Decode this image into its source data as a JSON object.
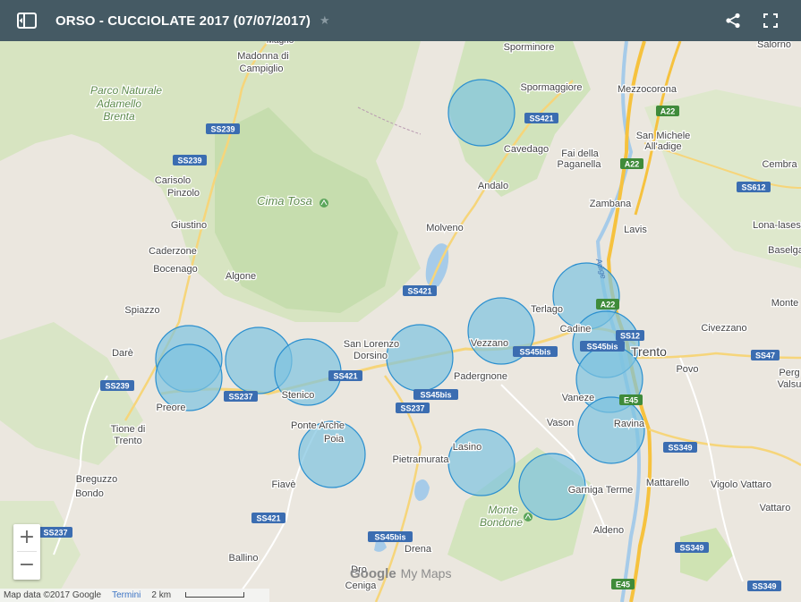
{
  "header": {
    "title": "ORSO - CUCCIOLATE 2017 (07/07/2017)",
    "star_icon": "star-icon",
    "share_icon": "share-icon",
    "fullscreen_icon": "fullscreen-icon",
    "menu_icon": "open-sidebar-icon"
  },
  "colors": {
    "header_bg": "#455a64",
    "circle_fill": "#7ec3df",
    "circle_stroke": "#2a8fcf",
    "road_highway": "#f6c23e",
    "terrain_green": "#cfe3b3"
  },
  "map": {
    "labels": [
      {
        "id": "parco",
        "text": "Parco Naturale"
      },
      {
        "id": "adamello",
        "text": "Adamello"
      },
      {
        "id": "brenta",
        "text": "Brenta"
      },
      {
        "id": "madonna",
        "text": "Madonna di"
      },
      {
        "id": "campiglio",
        "text": "Campiglio"
      },
      {
        "id": "magno",
        "text": "Magno"
      },
      {
        "id": "carisolo",
        "text": "Carisolo"
      },
      {
        "id": "pinzolo",
        "text": "Pinzolo"
      },
      {
        "id": "giustino",
        "text": "Giustino"
      },
      {
        "id": "caderzone",
        "text": "Caderzone"
      },
      {
        "id": "bocenago",
        "text": "Bocenago"
      },
      {
        "id": "algone",
        "text": "Algone"
      },
      {
        "id": "spiazzo",
        "text": "Spiazzo"
      },
      {
        "id": "dare",
        "text": "Darè"
      },
      {
        "id": "preore",
        "text": "Preore"
      },
      {
        "id": "tione",
        "text": "Tione di"
      },
      {
        "id": "trento2",
        "text": "Trento"
      },
      {
        "id": "breguzzo",
        "text": "Breguzzo"
      },
      {
        "id": "bondo",
        "text": "Bondo"
      },
      {
        "id": "cimatosa",
        "text": "Cima Tosa"
      },
      {
        "id": "stenico",
        "text": "Stenico"
      },
      {
        "id": "pontearche",
        "text": "Ponte Arche"
      },
      {
        "id": "poia",
        "text": "Poia"
      },
      {
        "id": "fiave",
        "text": "Fiavè"
      },
      {
        "id": "ballino",
        "text": "Ballino"
      },
      {
        "id": "sanlorenzo",
        "text": "San Lorenzo"
      },
      {
        "id": "dorsino",
        "text": "Dorsino"
      },
      {
        "id": "molveno",
        "text": "Molveno"
      },
      {
        "id": "andalo",
        "text": "Andalo"
      },
      {
        "id": "cavedago",
        "text": "Cavedago"
      },
      {
        "id": "sporminore",
        "text": "Sporminore"
      },
      {
        "id": "spormaggiore",
        "text": "Spormaggiore"
      },
      {
        "id": "fai",
        "text": "Fai della"
      },
      {
        "id": "paganella",
        "text": "Paganella"
      },
      {
        "id": "mezzocorona",
        "text": "Mezzocorona"
      },
      {
        "id": "sanmichele",
        "text": "San Michele"
      },
      {
        "id": "alladige",
        "text": "All'adige"
      },
      {
        "id": "salorno",
        "text": "Salorno"
      },
      {
        "id": "cembra",
        "text": "Cembra"
      },
      {
        "id": "zambana",
        "text": "Zambana"
      },
      {
        "id": "lavis",
        "text": "Lavis"
      },
      {
        "id": "lonalases",
        "text": "Lona-lases"
      },
      {
        "id": "baselga",
        "text": "Baselga"
      },
      {
        "id": "monte",
        "text": "Monte"
      },
      {
        "id": "terlago",
        "text": "Terlago"
      },
      {
        "id": "cadine",
        "text": "Cadine"
      },
      {
        "id": "vezzano",
        "text": "Vezzano"
      },
      {
        "id": "padergnone",
        "text": "Padergnone"
      },
      {
        "id": "trento",
        "text": "Trento"
      },
      {
        "id": "povo",
        "text": "Povo"
      },
      {
        "id": "civezzano",
        "text": "Civezzano"
      },
      {
        "id": "perg",
        "text": "Perg"
      },
      {
        "id": "valsu",
        "text": "Valsu"
      },
      {
        "id": "vaneze",
        "text": "Vaneze"
      },
      {
        "id": "vason",
        "text": "Vason"
      },
      {
        "id": "ravina",
        "text": "Ravina"
      },
      {
        "id": "lasino",
        "text": "Lasino"
      },
      {
        "id": "pietramurata",
        "text": "Pietramurata"
      },
      {
        "id": "garniga",
        "text": "Garniga Terme"
      },
      {
        "id": "montebondone1",
        "text": "Monte"
      },
      {
        "id": "montebondone2",
        "text": "Bondone"
      },
      {
        "id": "mattarello",
        "text": "Mattarello"
      },
      {
        "id": "vigolo",
        "text": "Vigolo Vattaro"
      },
      {
        "id": "vattaro",
        "text": "Vattaro"
      },
      {
        "id": "aldeno",
        "text": "Aldeno"
      },
      {
        "id": "drena",
        "text": "Drena"
      },
      {
        "id": "dro",
        "text": "Dro"
      },
      {
        "id": "ceniga",
        "text": "Ceniga"
      }
    ],
    "road_shields": [
      {
        "id": "ss239a",
        "text": "SS239"
      },
      {
        "id": "ss239b",
        "text": "SS239"
      },
      {
        "id": "ss239c",
        "text": "SS239"
      },
      {
        "id": "ss237a",
        "text": "SS237"
      },
      {
        "id": "ss237b",
        "text": "SS237"
      },
      {
        "id": "ss237c",
        "text": "SS237"
      },
      {
        "id": "ss421a",
        "text": "SS421"
      },
      {
        "id": "ss421b",
        "text": "SS421"
      },
      {
        "id": "ss421c",
        "text": "SS421"
      },
      {
        "id": "ss421d",
        "text": "SS421"
      },
      {
        "id": "ss45bisa",
        "text": "SS45bis"
      },
      {
        "id": "ss45bisb",
        "text": "SS45bis"
      },
      {
        "id": "ss45bisc",
        "text": "SS45bis"
      },
      {
        "id": "ss45bisd",
        "text": "SS45bis"
      },
      {
        "id": "a22a",
        "text": "A22"
      },
      {
        "id": "a22b",
        "text": "A22"
      },
      {
        "id": "a22c",
        "text": "A22"
      },
      {
        "id": "ss12",
        "text": "SS12"
      },
      {
        "id": "e45a",
        "text": "E45"
      },
      {
        "id": "e45b",
        "text": "E45"
      },
      {
        "id": "ss349a",
        "text": "SS349"
      },
      {
        "id": "ss349b",
        "text": "SS349"
      },
      {
        "id": "ss349c",
        "text": "SS349"
      },
      {
        "id": "ss612",
        "text": "SS612"
      },
      {
        "id": "ss47",
        "text": "SS47"
      }
    ],
    "river_label": "Adige",
    "circle_count": 14
  },
  "controls": {
    "zoom_in": "+",
    "zoom_out": "−"
  },
  "footer": {
    "map_data": "Map data ©2017 Google",
    "terms": "Termini",
    "scale": "2 km"
  },
  "branding": {
    "google": "Google",
    "mymaps": "My Maps"
  }
}
